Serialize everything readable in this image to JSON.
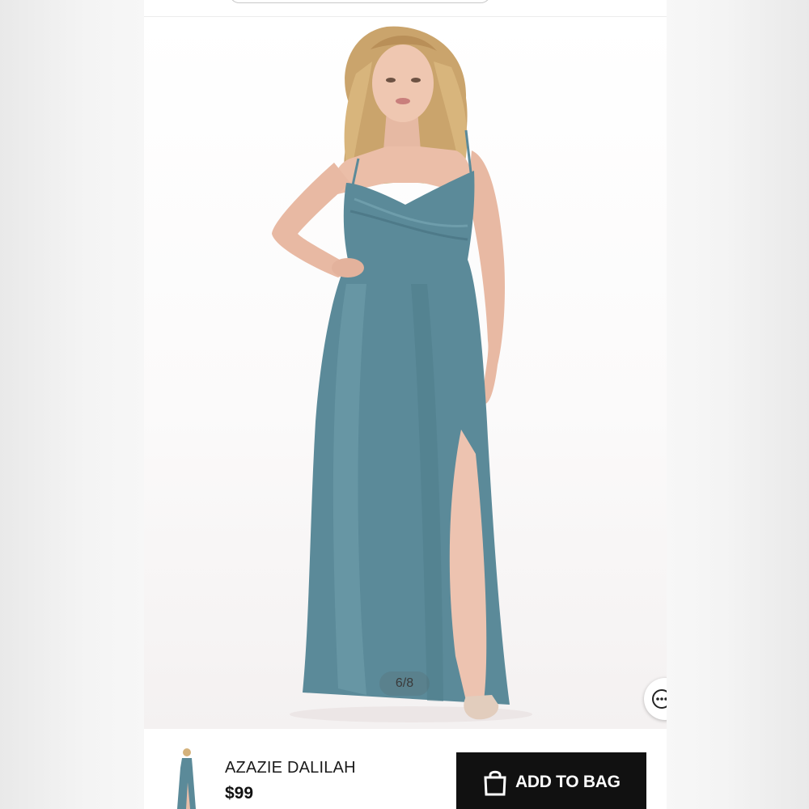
{
  "gallery": {
    "counter": "6/8",
    "image": "model-in-dusty-blue-satin-gown",
    "dress_color": "#5b8a99"
  },
  "product": {
    "name": "AZAZIE DALILAH",
    "price": "$99",
    "thumbnail": "dress-thumbnail"
  },
  "actions": {
    "add_to_bag_label": "ADD TO BAG",
    "add_to_bag_icon": "shopping-bag-icon",
    "more_icon": "more-options-icon"
  }
}
